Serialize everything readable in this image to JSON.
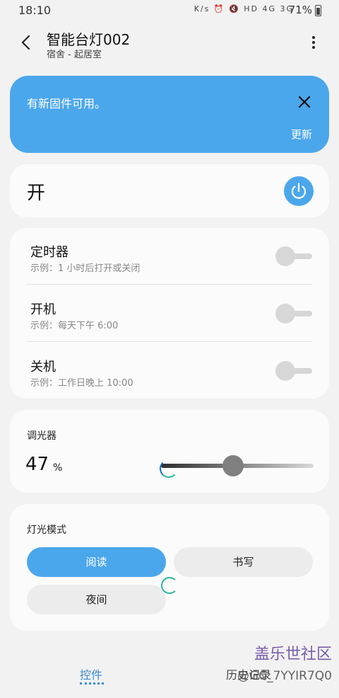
{
  "status_bar": {
    "time": "18:10",
    "icons": "K/s ⏰ 🔇 HD 4G 3G",
    "battery": "71%"
  },
  "app_bar": {
    "title": "智能台灯002",
    "subtitle": "宿舍 - 起居室"
  },
  "banner": {
    "message": "有新固件可用。",
    "update_label": "更新"
  },
  "power": {
    "state_label": "开"
  },
  "schedule": [
    {
      "title": "定时器",
      "subtitle": "示例：1 小时后打开或关闭"
    },
    {
      "title": "开机",
      "subtitle": "示例：每天下午 6:00"
    },
    {
      "title": "关机",
      "subtitle": "示例：工作日晚上 10:00"
    }
  ],
  "dimmer": {
    "label": "调光器",
    "value": "47",
    "unit": "%",
    "level": 0.47
  },
  "light_mode": {
    "label": "灯光模式",
    "options": [
      "阅读",
      "书写",
      "夜间"
    ],
    "selected": "阅读"
  },
  "tabs": {
    "controls": "控件",
    "history": "历史记录"
  },
  "watermark": {
    "brand": "盖乐世社区",
    "user": "@GC_7YYIR7Q0"
  },
  "colors": {
    "accent": "#4ba7eb",
    "card": "#fbfbfb",
    "background": "#f2f2f2"
  }
}
